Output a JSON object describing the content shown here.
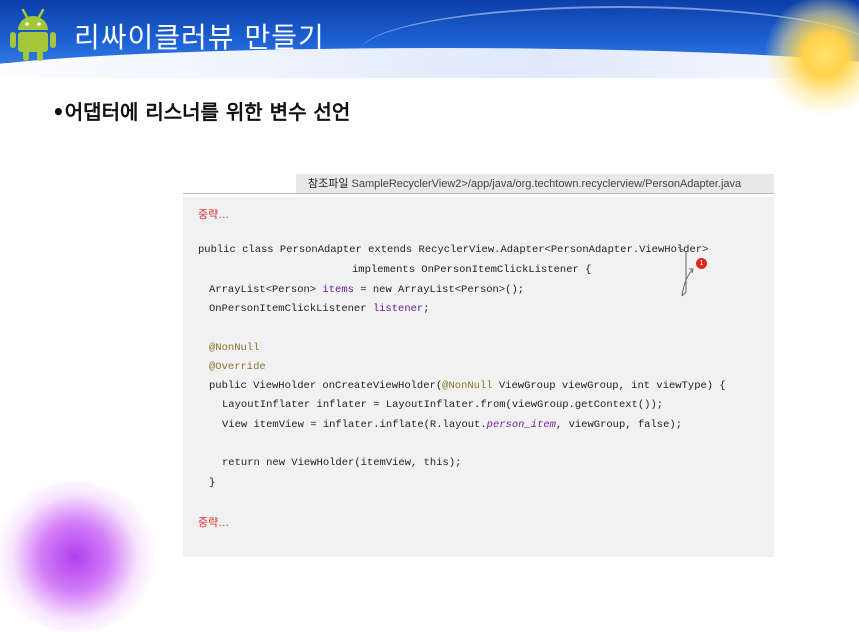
{
  "header": {
    "title": "리싸이클러뷰 만들기"
  },
  "slide": {
    "bullet": "•어댑터에 리스너를 위한 변수 선언"
  },
  "reference": {
    "label": "참조파일",
    "path": "SampleRecyclerView2>/app/java/org.techtown.recyclerview/PersonAdapter.java"
  },
  "code": {
    "omit_top": "중략…",
    "omit_bottom": "중략…",
    "line1": "public class PersonAdapter extends RecyclerView.Adapter<PersonAdapter.ViewHolder>",
    "line2": "implements OnPersonItemClickListener {",
    "line3_a": "ArrayList<Person> ",
    "line3_b": "items",
    "line3_c": " = new ArrayList<Person>();",
    "line4_a": "OnPersonItemClickListener ",
    "line4_b": "listener",
    "line4_c": ";",
    "line5": "@NonNull",
    "line6": "@Override",
    "line7_a": "public ViewHolder onCreateViewHolder(",
    "line7_b": "@NonNull",
    "line7_c": " ViewGroup viewGroup, int viewType) {",
    "line8": "LayoutInflater inflater = LayoutInflater.from(viewGroup.getContext());",
    "line9_a": "View itemView = inflater.inflate(R.layout.",
    "line9_b": "person_item",
    "line9_c": ", viewGroup, false);",
    "line10": "return new ViewHolder(itemView, this);",
    "line11": "}"
  },
  "marker": {
    "number": "1"
  },
  "colors": {
    "banner": "#1e63d6",
    "omit": "#d9302f",
    "annotation": "#8a7430",
    "field": "#6a1b9a",
    "badge": "#e0261e"
  }
}
